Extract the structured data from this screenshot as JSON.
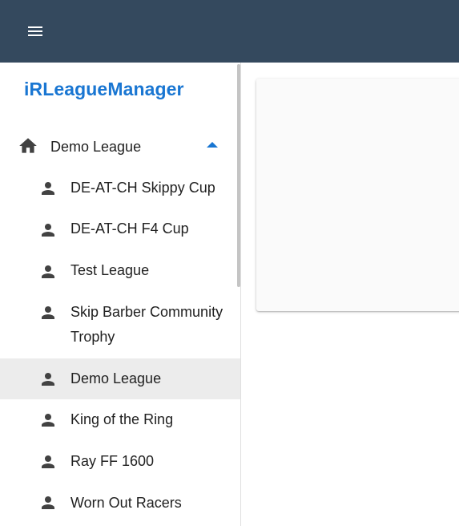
{
  "appbar": {
    "menu_icon": "hamburger-menu-icon",
    "background": "#34495e"
  },
  "brand": {
    "title": "iRLeagueManager",
    "color": "#1976d2"
  },
  "nav": {
    "group": {
      "icon": "home-icon",
      "label": "Demo League",
      "expanded": true,
      "caret_icon": "caret-up-icon"
    },
    "items": [
      {
        "icon": "person-icon",
        "label": "DE-AT-CH Skippy Cup",
        "active": false
      },
      {
        "icon": "person-icon",
        "label": "DE-AT-CH F4 Cup",
        "active": false
      },
      {
        "icon": "person-icon",
        "label": "Test League",
        "active": false
      },
      {
        "icon": "person-icon",
        "label": "Skip Barber Community Trophy",
        "active": false
      },
      {
        "icon": "person-icon",
        "label": "Demo League",
        "active": true
      },
      {
        "icon": "person-icon",
        "label": "King of the Ring",
        "active": false
      },
      {
        "icon": "person-icon",
        "label": "Ray FF 1600",
        "active": false
      },
      {
        "icon": "person-icon",
        "label": "Worn Out Racers",
        "active": false
      }
    ]
  }
}
